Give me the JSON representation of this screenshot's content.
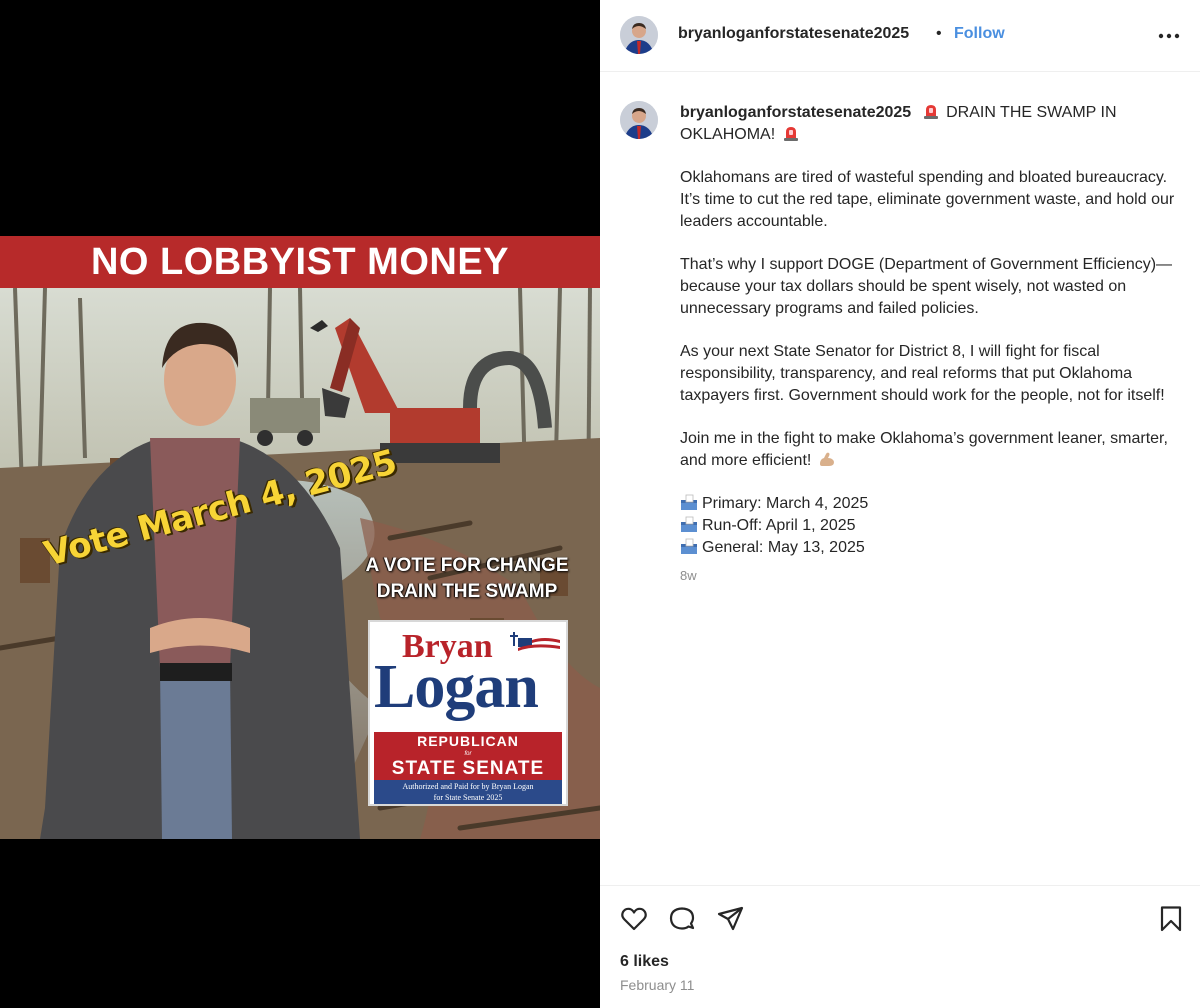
{
  "post": {
    "username": "bryanloganforstatesenate2025",
    "header_separator": "•",
    "follow_label": "Follow",
    "more_icon": "more-options-icon",
    "image": {
      "banner": "NO LOBBYIST MONEY",
      "vote_date": "Vote  March  4, 2025",
      "slogan_line1": "A VOTE FOR CHANGE",
      "slogan_line2": "DRAIN  THE SWAMP",
      "sign_first_name": "Bryan",
      "sign_last_name": "Logan",
      "sign_party": "REPUBLICAN",
      "sign_for": "for",
      "sign_office": "STATE SENATE",
      "sign_auth_line1": "Authorized and Paid for by Bryan Logan",
      "sign_auth_line2": "for State Senate 2025"
    },
    "caption": {
      "headline_a": "DRAIN THE SWAMP IN",
      "headline_b": "OKLAHOMA!",
      "para1": "Oklahomans are tired of wasteful spending and bloated bureaucracy. It’s time to cut the red tape, eliminate government waste, and hold our leaders accountable.",
      "para2": "That’s why I support DOGE (Department of Government Efficiency)—because your tax dollars should be spent wisely, not wasted on unnecessary programs and failed policies.",
      "para3": "As your next State Senator for District 8, I will fight for fiscal responsibility, transparency, and real reforms that put Oklahoma taxpayers first. Government should work for the people, not for itself!",
      "para4": "Join me in the fight to make Oklahoma’s government leaner, smarter, and more efficient!",
      "dates": [
        "Primary: March 4, 2025",
        "Run-Off: April 1, 2025",
        "General: May 13, 2025"
      ],
      "age": "8w"
    },
    "likes": "6 likes",
    "date": "February 11",
    "icons": {
      "like": "heart-icon",
      "comment": "comment-icon",
      "share": "send-icon",
      "save": "bookmark-icon",
      "siren": "siren-icon",
      "muscle": "flexed-biceps-icon",
      "ballot": "ballot-box-icon"
    },
    "colors": {
      "follow": "#4a8fe0",
      "banner": "#b72a2a",
      "sign_blue": "#1f3d7a",
      "sign_red": "#b8232a",
      "vote_yellow": "#f7d436"
    }
  }
}
